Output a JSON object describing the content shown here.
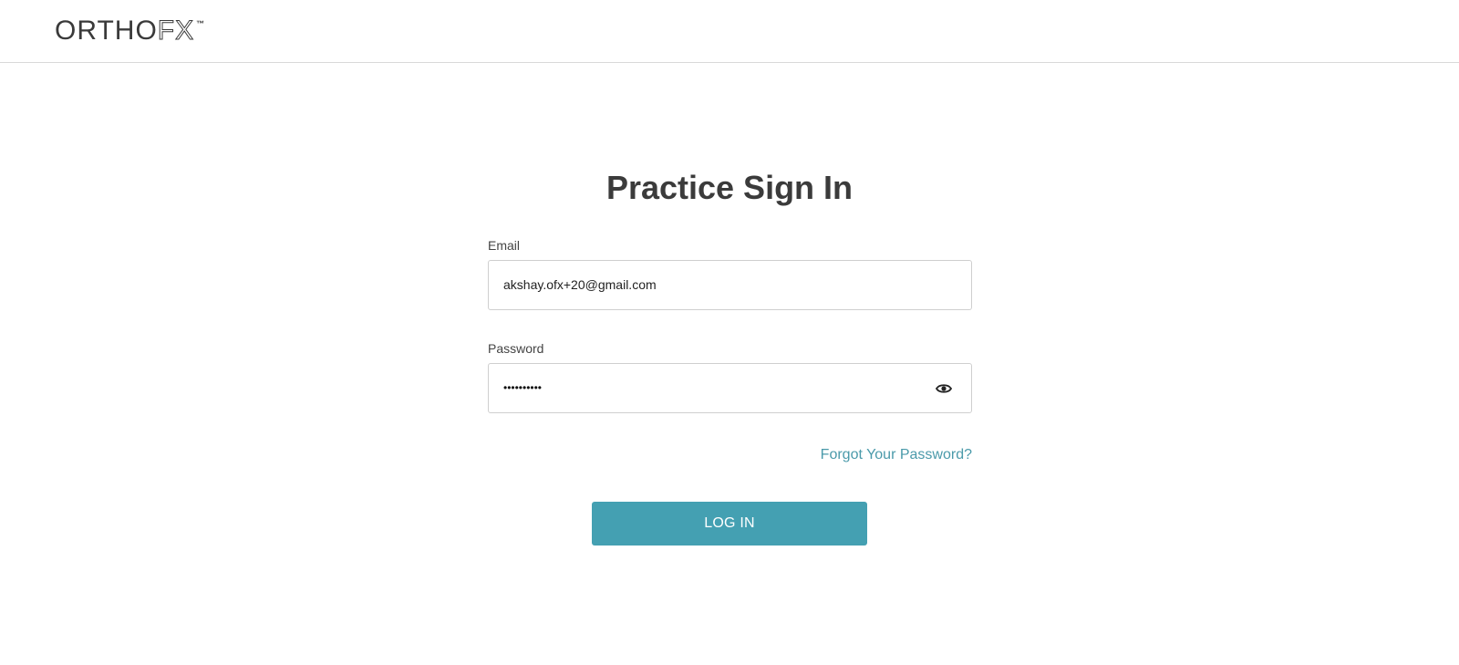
{
  "header": {
    "logo": {
      "solid_text": "ORTHO",
      "outline_text": "FX",
      "trademark": "™"
    }
  },
  "main": {
    "title": "Practice Sign In",
    "email": {
      "label": "Email",
      "value": "akshay.ofx+20@gmail.com"
    },
    "password": {
      "label": "Password",
      "masked_value": "••••••••••",
      "toggle_icon": "eye-icon"
    },
    "forgot_link": "Forgot Your Password?",
    "login_button": "LOG IN"
  },
  "colors": {
    "accent": "#44a0b2",
    "link": "#4a9aaa",
    "text": "#3b3b3b",
    "border": "#cfcfcf"
  }
}
